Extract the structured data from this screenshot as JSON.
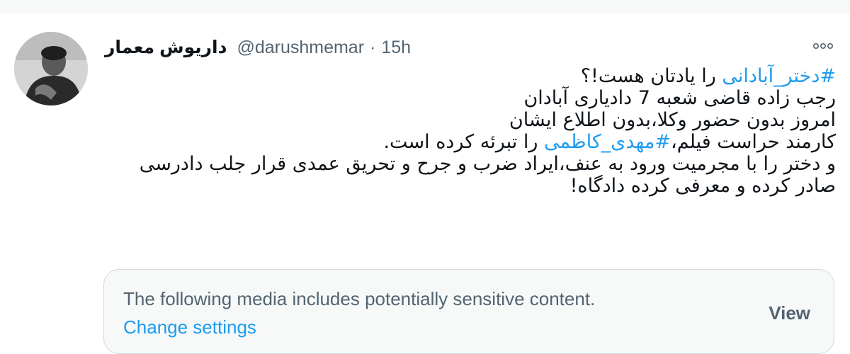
{
  "tweet": {
    "display_name": "داریوش معمار",
    "handle": "@darushmemar",
    "separator": "·",
    "time": "15h",
    "more_icon": "more-horizontal-icon",
    "lines": [
      {
        "hashtag": "#دختر_آبادانی",
        "rest": " را یادتان هست!؟"
      },
      {
        "text": "رجب زاده قاضی شعبه 7 دادیاری آبادان"
      },
      {
        "text": "امروز بدون حضور وکلا،بدون اطلاع ایشان"
      },
      {
        "pre": "کارمند حراست فیلم،",
        "hashtag": "#مهدی_کاظمی",
        "rest": " را تبرئه کرده است."
      },
      {
        "text": "و دختر را با مجرمیت ورود به عنف،ایراد ضرب و جرح و تحریق عمدی قرار جلب دادرسی"
      },
      {
        "text": "صادر کرده و معرفی کرده دادگاه!"
      }
    ]
  },
  "media_warning": {
    "message": "The following media includes potentially sensitive content.",
    "change_settings": "Change settings",
    "view": "View"
  },
  "colors": {
    "accent": "#1d9bf0",
    "secondary_text": "#536471",
    "primary_text": "#0f1419"
  }
}
